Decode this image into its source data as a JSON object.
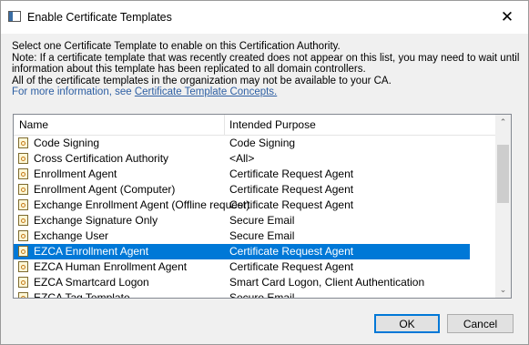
{
  "window": {
    "title": "Enable Certificate Templates",
    "close_glyph": "✕"
  },
  "description": {
    "line1": "Select one Certificate Template to enable on this Certification Authority.",
    "line2": "Note: If a certificate template that was recently created does not appear on this list, you may need to wait until",
    "line3": "information about this template has been replicated to all domain controllers.",
    "line4": "All of the certificate templates in the organization may not be available to your CA.",
    "more_prefix": "For more information, see ",
    "more_link": "Certificate Template Concepts."
  },
  "list": {
    "columns": {
      "name": "Name",
      "purpose": "Intended Purpose"
    },
    "rows": [
      {
        "name": "Code Signing",
        "purpose": "Code Signing"
      },
      {
        "name": "Cross Certification Authority",
        "purpose": "<All>"
      },
      {
        "name": "Enrollment Agent",
        "purpose": "Certificate Request Agent"
      },
      {
        "name": "Enrollment Agent (Computer)",
        "purpose": "Certificate Request Agent"
      },
      {
        "name": "Exchange Enrollment Agent (Offline request)",
        "purpose": "Certificate Request Agent"
      },
      {
        "name": "Exchange Signature Only",
        "purpose": "Secure Email"
      },
      {
        "name": "Exchange User",
        "purpose": "Secure Email"
      },
      {
        "name": "EZCA Enrollment Agent",
        "purpose": "Certificate Request Agent"
      },
      {
        "name": "EZCA Human Enrollment Agent",
        "purpose": "Certificate Request Agent"
      },
      {
        "name": "EZCA Smartcard Logon",
        "purpose": "Smart Card Logon, Client Authentication"
      },
      {
        "name": "EZCA Tag Template",
        "purpose": "Secure Email"
      }
    ],
    "selected_row": "EZCA Enrollment Agent",
    "scroll_up_glyph": "⌃",
    "scroll_down_glyph": "⌄"
  },
  "buttons": {
    "ok": "OK",
    "cancel": "Cancel"
  },
  "colors": {
    "selection": "#0078d7",
    "link": "#2d5fa3"
  }
}
